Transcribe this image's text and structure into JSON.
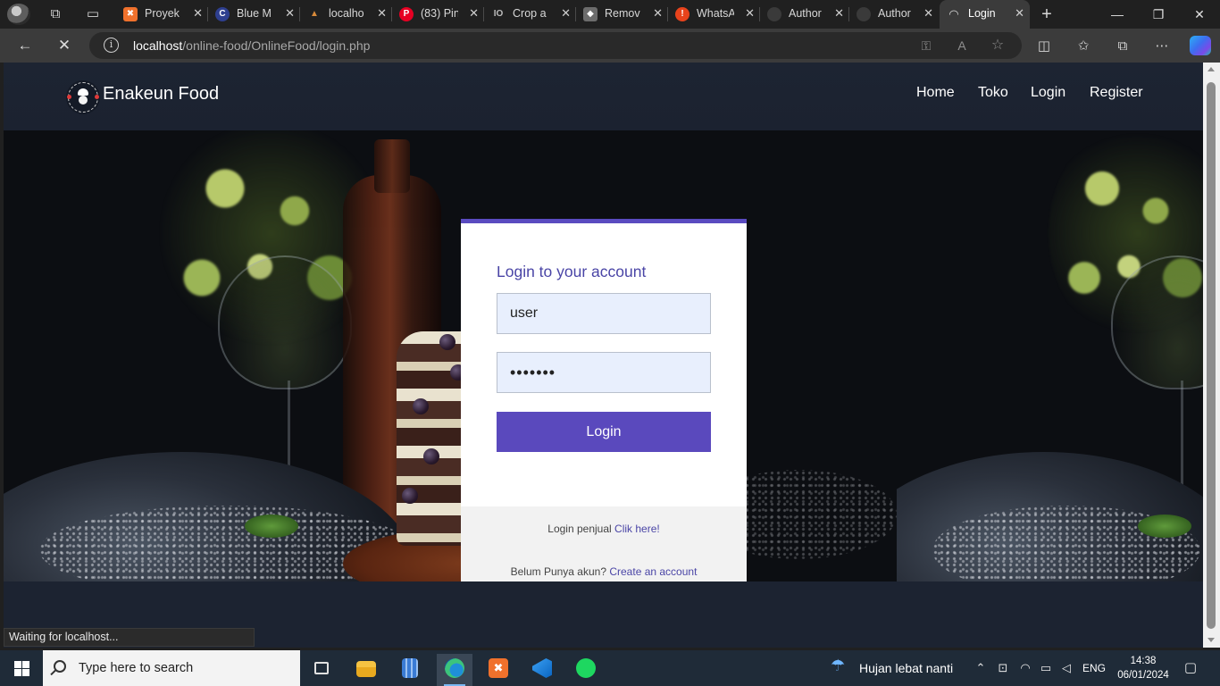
{
  "browser": {
    "tabs": [
      {
        "title": "Proyek",
        "favicon": "xampp-icon",
        "color": "#f0712c"
      },
      {
        "title": "Blue M",
        "favicon": "canva-icon",
        "color": "#2e3f8f"
      },
      {
        "title": "localho",
        "favicon": "xampp-warning-icon",
        "color": "#b5652b"
      },
      {
        "title": "(83) Pin",
        "favicon": "pinterest-icon",
        "color": "#e60023"
      },
      {
        "title": "Crop a",
        "favicon": "crop-tool-icon",
        "color": "#5a5a5a"
      },
      {
        "title": "Remov",
        "favicon": "remove-bg-icon",
        "color": "#6c6c6c"
      },
      {
        "title": "WhatsA",
        "favicon": "alert-icon",
        "color": "#e8431c"
      },
      {
        "title": "Author",
        "favicon": "github-icon",
        "color": "#2a2a2a"
      },
      {
        "title": "Author",
        "favicon": "github-icon",
        "color": "#2a2a2a"
      }
    ],
    "active_tab": {
      "title": "Login",
      "favicon": "loading-spinner-icon"
    },
    "new_tab_glyph": "+",
    "url_host": "localhost",
    "url_path": "/online-food/OnlineFood/login.php"
  },
  "site": {
    "brand": "Enakeun Food",
    "menu": [
      "Home",
      "Toko",
      "Login",
      "Register"
    ]
  },
  "login": {
    "title": "Login to your account",
    "username_value": "user",
    "password_value": "•••••••",
    "button_label": "Login",
    "seller_text": "Login penjual",
    "seller_link": "Clik here!",
    "register_text": "Belum Punya akun?",
    "register_link": "Create an account",
    "accent": "#5a49bd"
  },
  "status_text": "Waiting for localhost...",
  "taskbar": {
    "search_placeholder": "Type here to search",
    "apps": [
      "task-view-icon",
      "file-explorer-icon",
      "calculator-icon",
      "edge-icon",
      "xampp-icon",
      "vscode-icon",
      "spotify-icon"
    ],
    "weather": "Hujan lebat nanti",
    "language": "ENG",
    "time": "14:38",
    "date": "06/01/2024"
  }
}
